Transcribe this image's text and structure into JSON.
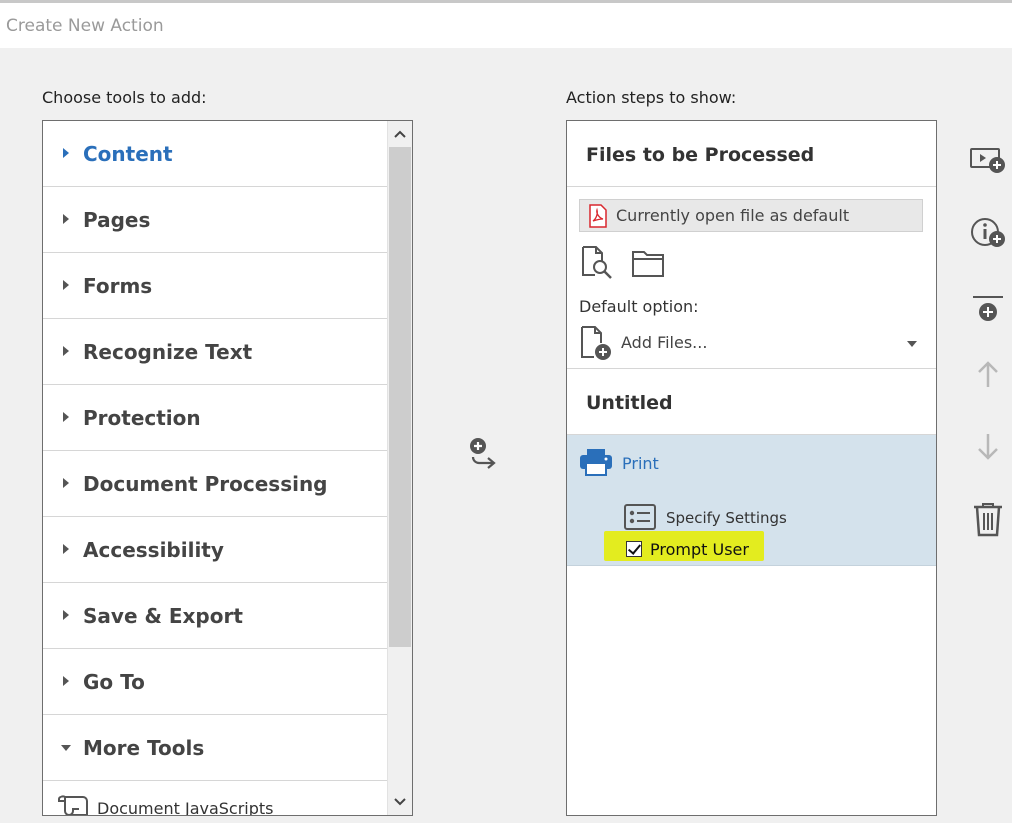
{
  "window": {
    "title": "Create New Action"
  },
  "left_panel": {
    "label": "Choose tools to add:",
    "tools": [
      {
        "label": "Content",
        "state": "active"
      },
      {
        "label": "Pages",
        "state": "collapsed"
      },
      {
        "label": "Forms",
        "state": "collapsed"
      },
      {
        "label": "Recognize Text",
        "state": "collapsed"
      },
      {
        "label": "Protection",
        "state": "collapsed"
      },
      {
        "label": "Document Processing",
        "state": "collapsed"
      },
      {
        "label": "Accessibility",
        "state": "collapsed"
      },
      {
        "label": "Save & Export",
        "state": "collapsed"
      },
      {
        "label": "Go To",
        "state": "collapsed"
      },
      {
        "label": "More Tools",
        "state": "expanded"
      }
    ],
    "sub_items": [
      {
        "label": "Document JavaScripts"
      }
    ]
  },
  "right_panel": {
    "label": "Action steps to show:",
    "files_section": {
      "heading": "Files to be Processed",
      "source_label": "Currently open file as default",
      "default_option_label": "Default option:",
      "default_option_value": "Add Files..."
    },
    "untitled_heading": "Untitled",
    "step": {
      "label": "Print",
      "settings_label": "Specify Settings",
      "prompt_label": "Prompt User",
      "prompt_checked": true
    }
  },
  "colors": {
    "accent": "#2a6fba",
    "highlight": "#e3ec1f",
    "step_bg": "#d4e2ec",
    "pdf_red": "#d9272e"
  },
  "icons": [
    "add-step-icon",
    "add-media-icon",
    "add-info-icon",
    "insert-stop-icon",
    "move-up-icon",
    "move-down-icon",
    "delete-icon",
    "pdf-file-icon",
    "file-search-icon",
    "folder-icon",
    "add-file-icon",
    "printer-icon",
    "settings-icon"
  ]
}
